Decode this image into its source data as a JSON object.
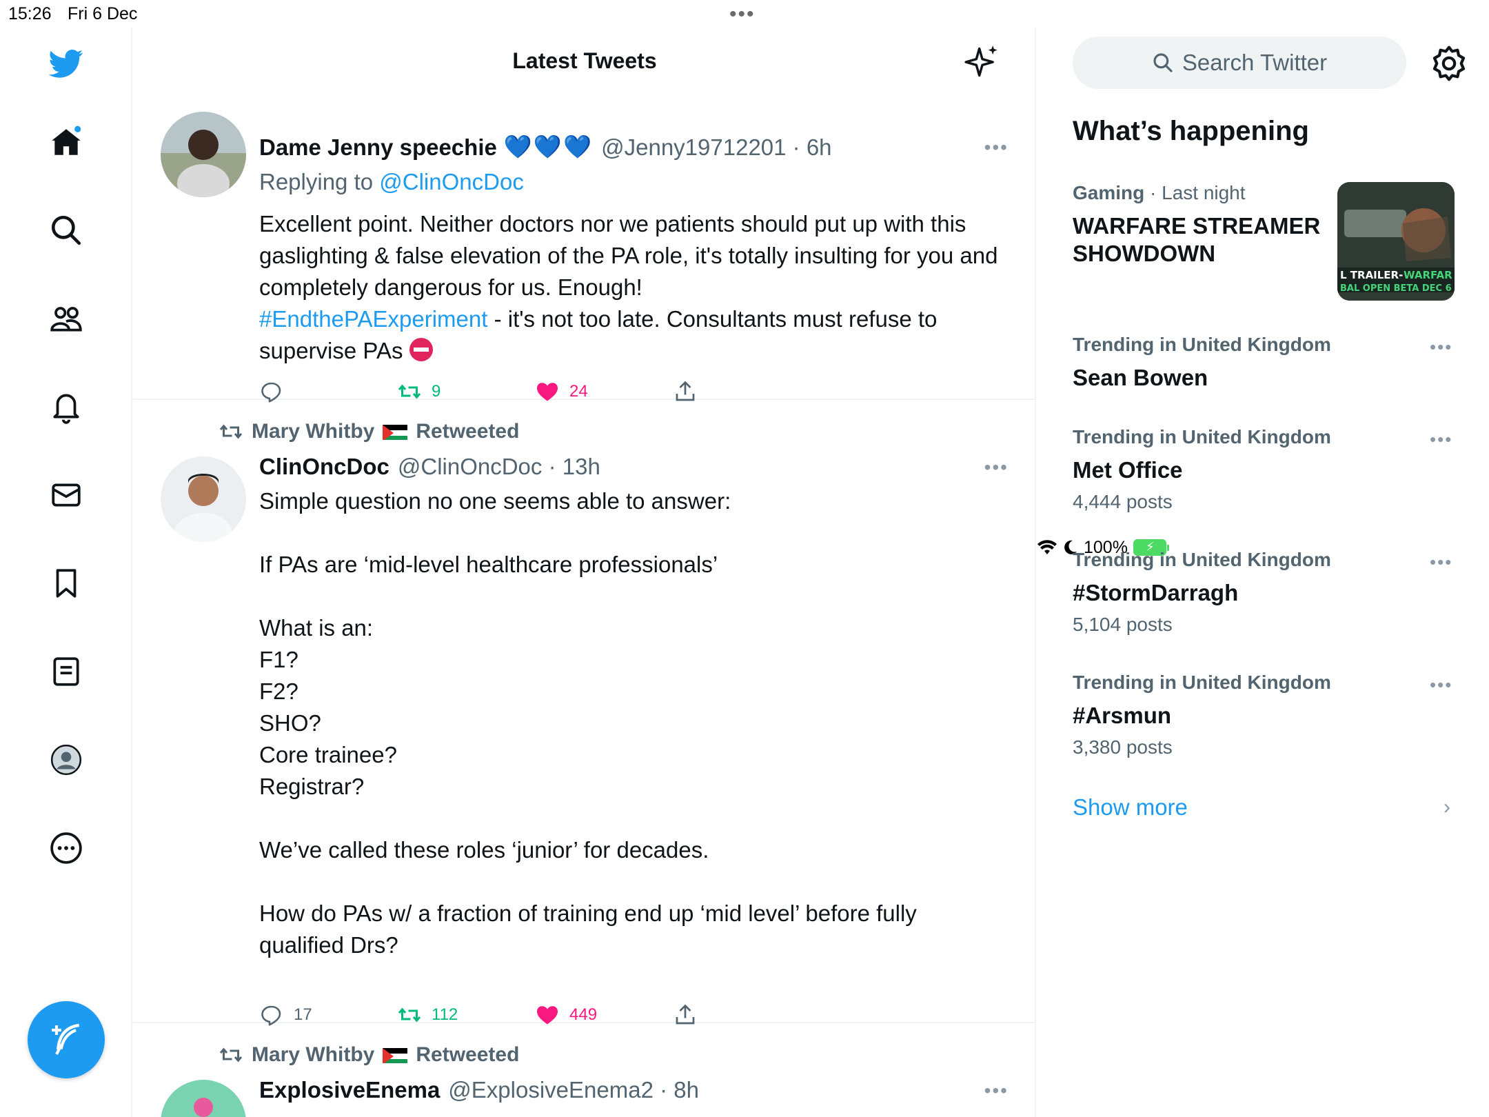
{
  "status_bar": {
    "time": "15:26",
    "date": "Fri 6 Dec",
    "battery": "100%"
  },
  "header": {
    "title": "Latest Tweets"
  },
  "tweets": [
    {
      "name": "Dame Jenny speechie",
      "emoji": "💙💙💙",
      "handle_time": "@Jenny19712201 · 6h",
      "replying_label": "Replying to ",
      "replying_to": "@ClinOncDoc",
      "text_part1": "Excellent point. Neither doctors nor we patients should put up with this gaslighting & false elevation of the PA role, it's totally insulting for you and completely dangerous for us. Enough!\n",
      "hashtag": "#EndthePAExperiment",
      "text_part2": " - it's not too late. Consultants must refuse to supervise PAs ",
      "replies": "",
      "retweets": "9",
      "likes": "24"
    },
    {
      "retweeted_by": "Mary Whitby",
      "retweeted_label": "Retweeted",
      "name": "ClinOncDoc",
      "handle_time": "@ClinOncDoc · 13h",
      "text": "Simple question no one seems able to answer:\n\nIf PAs are ‘mid-level healthcare professionals’\n\nWhat is an:\nF1?\nF2?\nSHO?\nCore trainee?\nRegistrar?\n\nWe’ve called these roles ‘junior’ for decades.\n\nHow do PAs w/ a fraction of training end up ‘mid level’ before fully qualified Drs?",
      "replies": "17",
      "retweets": "112",
      "likes": "449"
    },
    {
      "retweeted_by": "Mary Whitby",
      "retweeted_label": "Retweeted",
      "name": "ExplosiveEnema",
      "handle_time": "@ExplosiveEnema2 · 8h"
    }
  ],
  "sidebar": {
    "search_placeholder": "Search Twitter",
    "heading": "What’s happening",
    "trends": [
      {
        "category": "Gaming",
        "meta": " · Last night",
        "title": "WARFARE STREAMER SHOWDOWN",
        "count": "",
        "image_text": "L TRAILER-WARFAR\nBAL OPEN BETA DEC 6"
      },
      {
        "category": "Trending in United Kingdom",
        "title": "Sean Bowen",
        "count": ""
      },
      {
        "category": "Trending in United Kingdom",
        "title": "Met Office",
        "count": "4,444 posts"
      },
      {
        "category": "Trending in United Kingdom",
        "title": "#StormDarragh",
        "count": "5,104 posts"
      },
      {
        "category": "Trending in United Kingdom",
        "title": "#Arsmun",
        "count": "3,380 posts"
      }
    ],
    "show_more": "Show more"
  },
  "colors": {
    "accent": "#1d9bf0",
    "retweet": "#00ba7c",
    "like": "#f91880",
    "muted": "#536471"
  }
}
